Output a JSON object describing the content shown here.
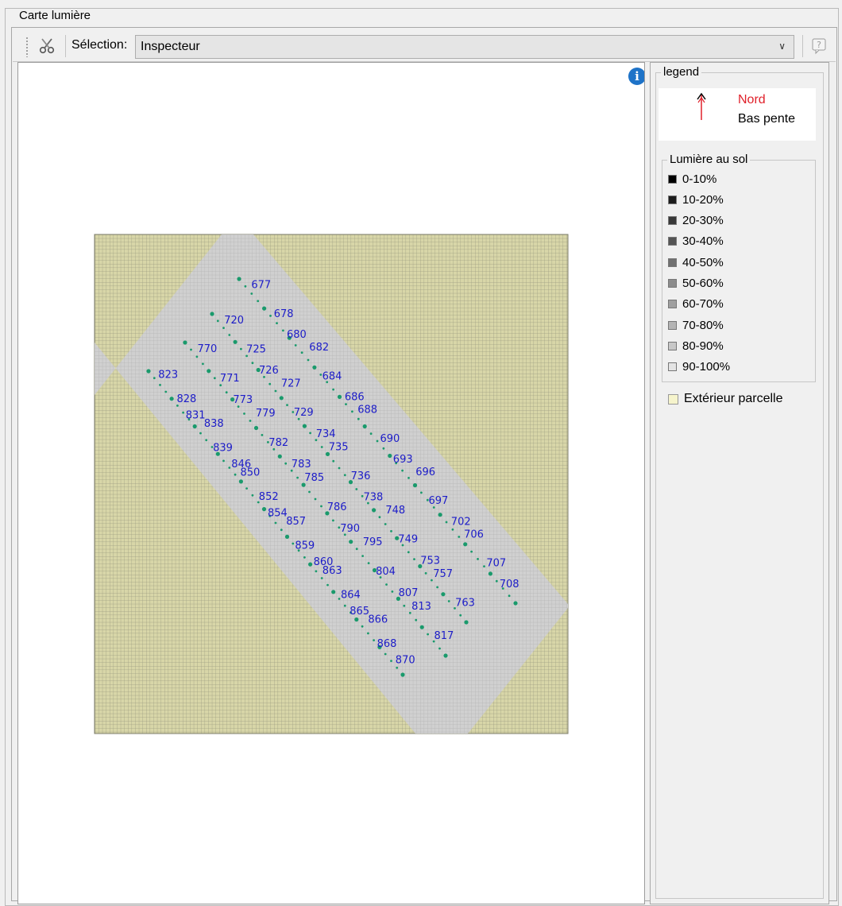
{
  "window": {
    "title": "Carte lumière"
  },
  "toolbar": {
    "tool_icon": "scissors-tools-icon",
    "selection_label": "Sélection:",
    "selection_value": "Inspecteur",
    "help_icon": "help-query-icon"
  },
  "map": {
    "info_icon": "info-icon",
    "colors": {
      "exterior": "#d8d6a8",
      "plot": "#d0d0d0",
      "grid": "#9b9b80",
      "trees": "#1a9a6c",
      "labels": "#1c1cc8"
    },
    "tree_labels": [
      {
        "label": "720",
        "row": 1
      },
      {
        "label": "677",
        "row": 0
      },
      {
        "label": "678",
        "row": 0
      },
      {
        "label": "680",
        "row": 0
      },
      {
        "label": "682",
        "row": 0
      },
      {
        "label": "684",
        "row": 0
      },
      {
        "label": "686",
        "row": 0
      },
      {
        "label": "688",
        "row": 0
      },
      {
        "label": "690",
        "row": 0
      },
      {
        "label": "693",
        "row": 0
      },
      {
        "label": "696",
        "row": 0
      },
      {
        "label": "697",
        "row": 0
      },
      {
        "label": "702",
        "row": 0
      },
      {
        "label": "706",
        "row": 0
      },
      {
        "label": "707",
        "row": 0
      },
      {
        "label": "708",
        "row": 0
      },
      {
        "label": "770",
        "row": 2
      },
      {
        "label": "771",
        "row": 2
      },
      {
        "label": "773",
        "row": 2
      },
      {
        "label": "779",
        "row": 2
      },
      {
        "label": "782",
        "row": 2
      },
      {
        "label": "783",
        "row": 2
      },
      {
        "label": "785",
        "row": 2
      },
      {
        "label": "786",
        "row": 2
      },
      {
        "label": "790",
        "row": 2
      },
      {
        "label": "795",
        "row": 2
      },
      {
        "label": "725",
        "row": 1
      },
      {
        "label": "726",
        "row": 1
      },
      {
        "label": "727",
        "row": 1
      },
      {
        "label": "729",
        "row": 1
      },
      {
        "label": "734",
        "row": 1
      },
      {
        "label": "735",
        "row": 1
      },
      {
        "label": "736",
        "row": 1
      },
      {
        "label": "738",
        "row": 1
      },
      {
        "label": "748",
        "row": 1
      },
      {
        "label": "749",
        "row": 1
      },
      {
        "label": "753",
        "row": 1
      },
      {
        "label": "757",
        "row": 1
      },
      {
        "label": "763",
        "row": 1
      },
      {
        "label": "823",
        "row": 3
      },
      {
        "label": "828",
        "row": 3
      },
      {
        "label": "831",
        "row": 3
      },
      {
        "label": "838",
        "row": 3
      },
      {
        "label": "839",
        "row": 3
      },
      {
        "label": "846",
        "row": 3
      },
      {
        "label": "850",
        "row": 3
      },
      {
        "label": "852",
        "row": 3
      },
      {
        "label": "854",
        "row": 3
      },
      {
        "label": "857",
        "row": 3
      },
      {
        "label": "859",
        "row": 3
      },
      {
        "label": "860",
        "row": 3
      },
      {
        "label": "863",
        "row": 3
      },
      {
        "label": "864",
        "row": 3
      },
      {
        "label": "865",
        "row": 3
      },
      {
        "label": "866",
        "row": 3
      },
      {
        "label": "868",
        "row": 3
      },
      {
        "label": "870",
        "row": 3
      },
      {
        "label": "804",
        "row": 2
      },
      {
        "label": "807",
        "row": 2
      },
      {
        "label": "813",
        "row": 2
      },
      {
        "label": "817",
        "row": 2
      }
    ]
  },
  "legend": {
    "title": "legend",
    "compass": {
      "north": "Nord",
      "slope": "Bas pente",
      "icon": "north-arrow-icon"
    },
    "light": {
      "title": "Lumière au sol",
      "items": [
        {
          "label": "0-10%",
          "color": "#000000"
        },
        {
          "label": "10-20%",
          "color": "#1c1c1c"
        },
        {
          "label": "20-30%",
          "color": "#383838"
        },
        {
          "label": "30-40%",
          "color": "#545454"
        },
        {
          "label": "40-50%",
          "color": "#707070"
        },
        {
          "label": "50-60%",
          "color": "#8c8c8c"
        },
        {
          "label": "60-70%",
          "color": "#a0a0a0"
        },
        {
          "label": "70-80%",
          "color": "#b4b4b4"
        },
        {
          "label": "80-90%",
          "color": "#c8c8c8"
        },
        {
          "label": "90-100%",
          "color": "#e4e4e4"
        }
      ]
    },
    "exterior": {
      "label": "Extérieur parcelle",
      "color": "#f6f4cc"
    }
  }
}
